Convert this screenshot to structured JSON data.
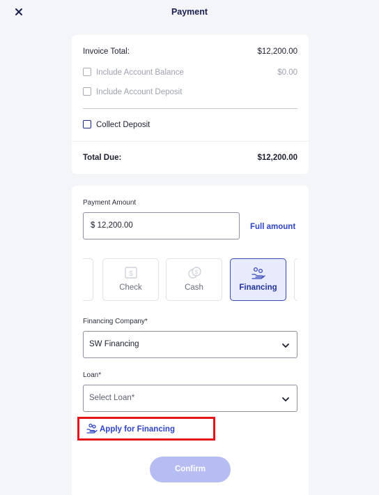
{
  "header": {
    "title": "Payment",
    "close_icon": "close-icon"
  },
  "summary": {
    "invoice_total_label": "Invoice Total:",
    "invoice_total_value": "$12,200.00",
    "include_balance_label": "Include Account Balance",
    "include_balance_value": "$0.00",
    "include_balance_checked": false,
    "include_deposit_label": "Include Account Deposit",
    "include_deposit_checked": false,
    "collect_deposit_label": "Collect Deposit",
    "collect_deposit_checked": false,
    "total_due_label": "Total Due:",
    "total_due_value": "$12,200.00"
  },
  "payment": {
    "amount_label": "Payment Amount",
    "amount_value": "$  12,200.00",
    "full_amount_label": "Full amount",
    "methods": [
      {
        "label": "Check",
        "icon": "check-icon",
        "selected": false
      },
      {
        "label": "Cash",
        "icon": "cash-icon",
        "selected": false
      },
      {
        "label": "Financing",
        "icon": "financing-icon",
        "selected": true
      }
    ],
    "financing_company_label": "Financing Company*",
    "financing_company_value": "SW Financing",
    "loan_label": "Loan*",
    "loan_placeholder": "Select Loan*",
    "apply_financing_label": "Apply for Financing",
    "confirm_label": "Confirm",
    "confirm_enabled": false
  },
  "colors": {
    "accent": "#2f45c4",
    "navy": "#1a1f4e",
    "highlight_box": "#e5151c",
    "confirm_disabled": "#b5bdf2",
    "selected_bg": "#e8ebfc"
  }
}
